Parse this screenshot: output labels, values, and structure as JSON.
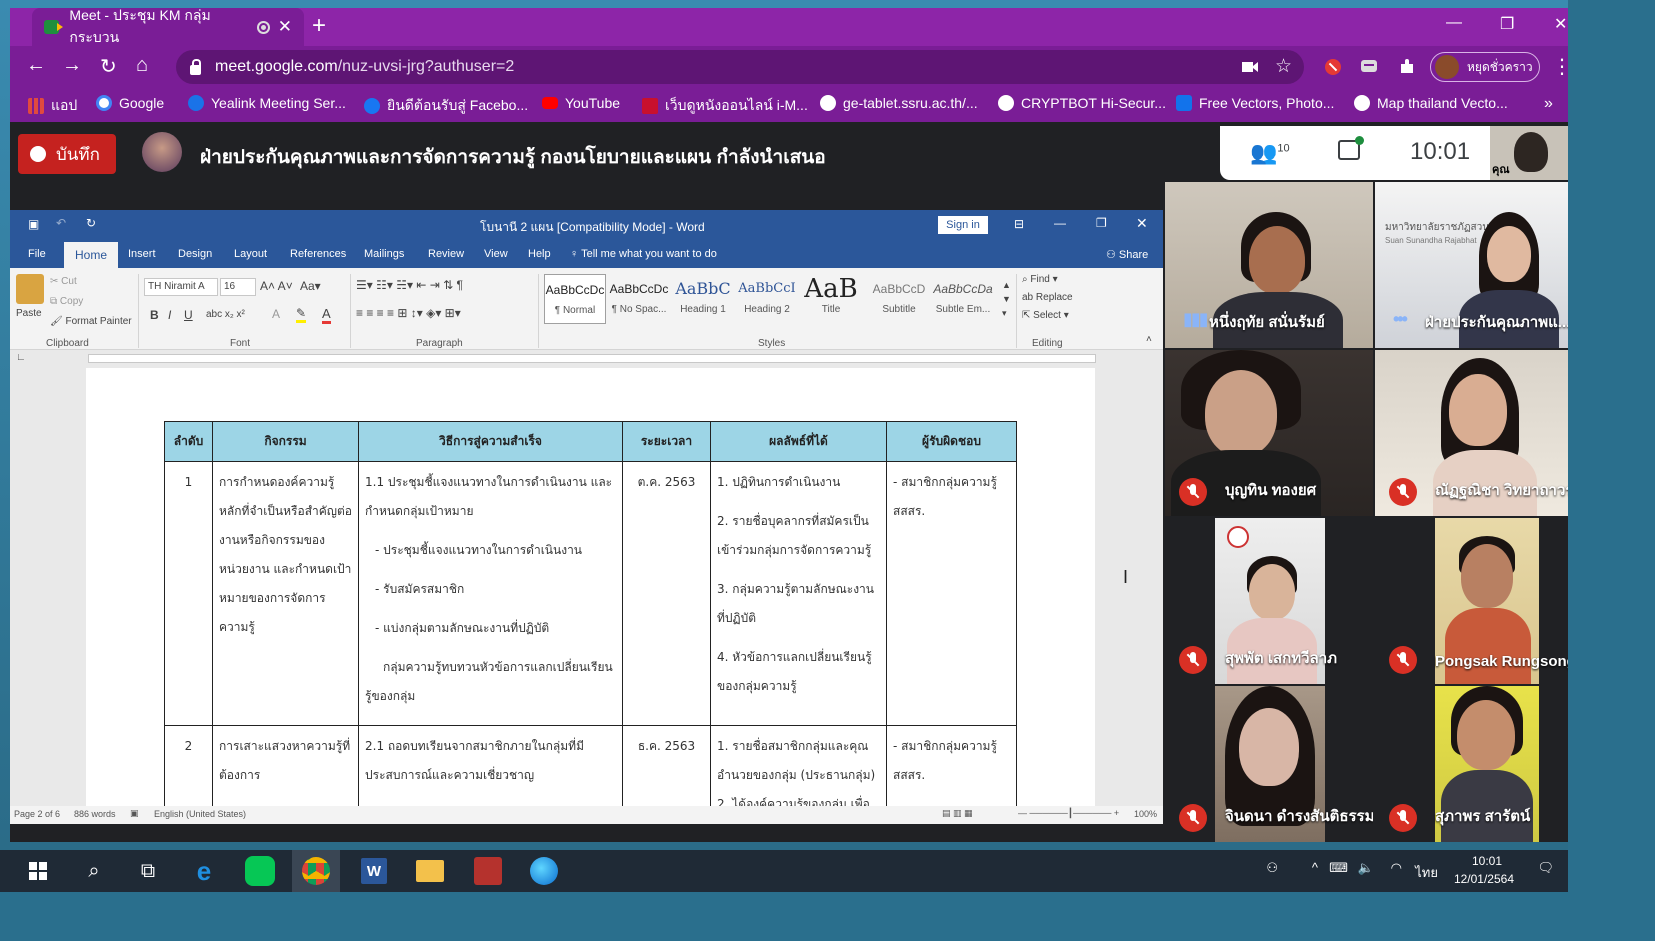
{
  "browser": {
    "tab_title": "Meet - ประชุม KM กลุ่ม กระบวน",
    "tab_close": "✕",
    "new_tab": "+",
    "window_controls": {
      "minimize": "—",
      "restore": "❐",
      "close": "✕"
    },
    "url_host": "meet.google.com",
    "url_path": "/nuz-uvsi-jrg?authuser=2",
    "profile_label": "หยุดชั่วคราว",
    "bookmarks": [
      {
        "label": "แอป",
        "icon": "apps-grid-icon",
        "color": "#e04a3f"
      },
      {
        "label": "Google",
        "icon": "google-icon",
        "color": "#4285f4"
      },
      {
        "label": "Yealink Meeting Ser...",
        "icon": "yealink-icon",
        "color": "#1a73e8"
      },
      {
        "label": "ยินดีต้อนรับสู่ Facebo...",
        "icon": "facebook-icon",
        "color": "#1877f2"
      },
      {
        "label": "YouTube",
        "icon": "youtube-icon",
        "color": "#ff0000"
      },
      {
        "label": "เว็บดูหนังออนไลน์ i-M...",
        "icon": "movie-site-icon",
        "color": "#c8102e"
      },
      {
        "label": "ge-tablet.ssru.ac.th/...",
        "icon": "globe-icon",
        "color": "#ffffff"
      },
      {
        "label": "CRYPTBOT Hi-Secur...",
        "icon": "globe-icon",
        "color": "#ffffff"
      },
      {
        "label": "Free Vectors, Photo...",
        "icon": "freepik-icon",
        "color": "#1273eb"
      },
      {
        "label": "Map thailand Vecto...",
        "icon": "globe-icon",
        "color": "#ffffff"
      }
    ],
    "bookmarks_more": "»"
  },
  "meet": {
    "record_label": "บันทึก",
    "presenter_title": "ฝ่ายประกันคุณภาพและการจัดการความรู้ กองนโยบายและแผน กำลังนำเสนอ",
    "participant_count": "10",
    "clock": "10:01",
    "self_label": "คุณ",
    "participants": [
      {
        "name": "หนึ่งฤทัย สนั่นรัมย์",
        "state": "speaking"
      },
      {
        "name": "ฝ่ายประกันคุณภาพแ...",
        "state": "speaking"
      },
      {
        "name": "บุญทิน ทองยศ",
        "state": "muted"
      },
      {
        "name": "ณัฏฐณิชา วิทยาถาวร",
        "state": "muted"
      },
      {
        "name": "สุพพัต เสกทวีลาภ",
        "state": "muted"
      },
      {
        "name": "Pongsak Rungsong",
        "state": "muted"
      },
      {
        "name": "จินดนา ดำรงสันติธรรม",
        "state": "muted"
      },
      {
        "name": "สุภาพร สารัตน์",
        "state": "muted"
      }
    ],
    "banner_text": "มหาวิทยาลัยราชภัฏสวนสุนันทา",
    "banner_sub": "Suan Sunandha Rajabhat"
  },
  "word": {
    "title": "โบนานี 2 แผน [Compatibility Mode] - Word",
    "sign_in": "Sign in",
    "tabs": [
      "File",
      "Home",
      "Insert",
      "Design",
      "Layout",
      "References",
      "Mailings",
      "Review",
      "View",
      "Help"
    ],
    "tell_me": "Tell me what you want to do",
    "share": "Share",
    "clipboard": {
      "paste": "Paste",
      "cut": "Cut",
      "copy": "Copy",
      "format_painter": "Format Painter",
      "group": "Clipboard"
    },
    "font": {
      "name": "TH Niramit A",
      "size": "16",
      "group": "Font"
    },
    "paragraph_group": "Paragraph",
    "styles": [
      {
        "preview": "AaBbCcDc",
        "name": "¶ Normal"
      },
      {
        "preview": "AaBbCcDc",
        "name": "¶ No Spac..."
      },
      {
        "preview": "AaBbC",
        "name": "Heading 1"
      },
      {
        "preview": "AaBbCcI",
        "name": "Heading 2"
      },
      {
        "preview": "AaB",
        "name": "Title"
      },
      {
        "preview": "AaBbCcD",
        "name": "Subtitle"
      },
      {
        "preview": "AaBbCcDa",
        "name": "Subtle Em..."
      }
    ],
    "styles_group": "Styles",
    "editing": {
      "find": "Find",
      "replace": "Replace",
      "select": "Select",
      "group": "Editing"
    },
    "status": {
      "page": "Page 2 of 6",
      "words": "886 words",
      "lang": "English (United States)",
      "zoom": "100%"
    },
    "table": {
      "headers": [
        "ลำดับ",
        "กิจกรรม",
        "วิธีการสู่ความสำเร็จ",
        "ระยะเวลา",
        "ผลลัพธ์ที่ได้",
        "ผู้รับผิดชอบ"
      ],
      "rows": [
        {
          "no": "1",
          "activity": "การกำหนดองค์ความรู้หลักที่จำเป็นหรือสำคัญต่องานหรือกิจกรรมของหน่วยงาน และกำหนดเป้าหมายของการจัดการความรู้",
          "method": [
            "1.1 ประชุมชี้แจงแนวทางในการดำเนินงาน และกำหนดกลุ่มเป้าหมาย",
            "- ประชุมชี้แจงแนวทางในการดำเนินงาน",
            "- รับสมัครสมาชิก",
            "- แบ่งกลุ่มตามลักษณะงานที่ปฏิบัติ",
            "กลุ่มความรู้ทบทวนหัวข้อการแลกเปลี่ยนเรียนรู้ของกลุ่ม"
          ],
          "period": "ต.ค. 2563",
          "results": [
            "1. ปฏิทินการดำเนินงาน",
            "2. รายชื่อบุคลากรที่สมัครเป็นเข้าร่วมกลุ่มการจัดการความรู้",
            "3. กลุ่มความรู้ตามลักษณะงานที่ปฏิบัติ",
            "4. หัวข้อการแลกเปลี่ยนเรียนรู้ของกลุ่มความรู้"
          ],
          "owner": "- สมาชิกกลุ่มความรู้ สสสร."
        },
        {
          "no": "2",
          "activity": "การเสาะแสวงหาความรู้ที่ต้องการ",
          "method": [
            "2.1 ถอดบทเรียนจากสมาชิกภายในกลุ่มที่มีประสบการณ์และความเชี่ยวชาญ"
          ],
          "period": "ธ.ค. 2563",
          "results": [
            "1. รายชื่อสมาชิกกลุ่มและคุณอำนวยของกลุ่ม (ประธานกลุ่ม)",
            "2. ได้องค์ความรู้ของกลุ่ม เพื่อ"
          ],
          "owner": "- สมาชิกกลุ่มความรู้ สสสร."
        }
      ]
    }
  },
  "taskbar": {
    "clock_time": "10:01",
    "clock_date": "12/01/2564",
    "lang": "ไทย"
  }
}
